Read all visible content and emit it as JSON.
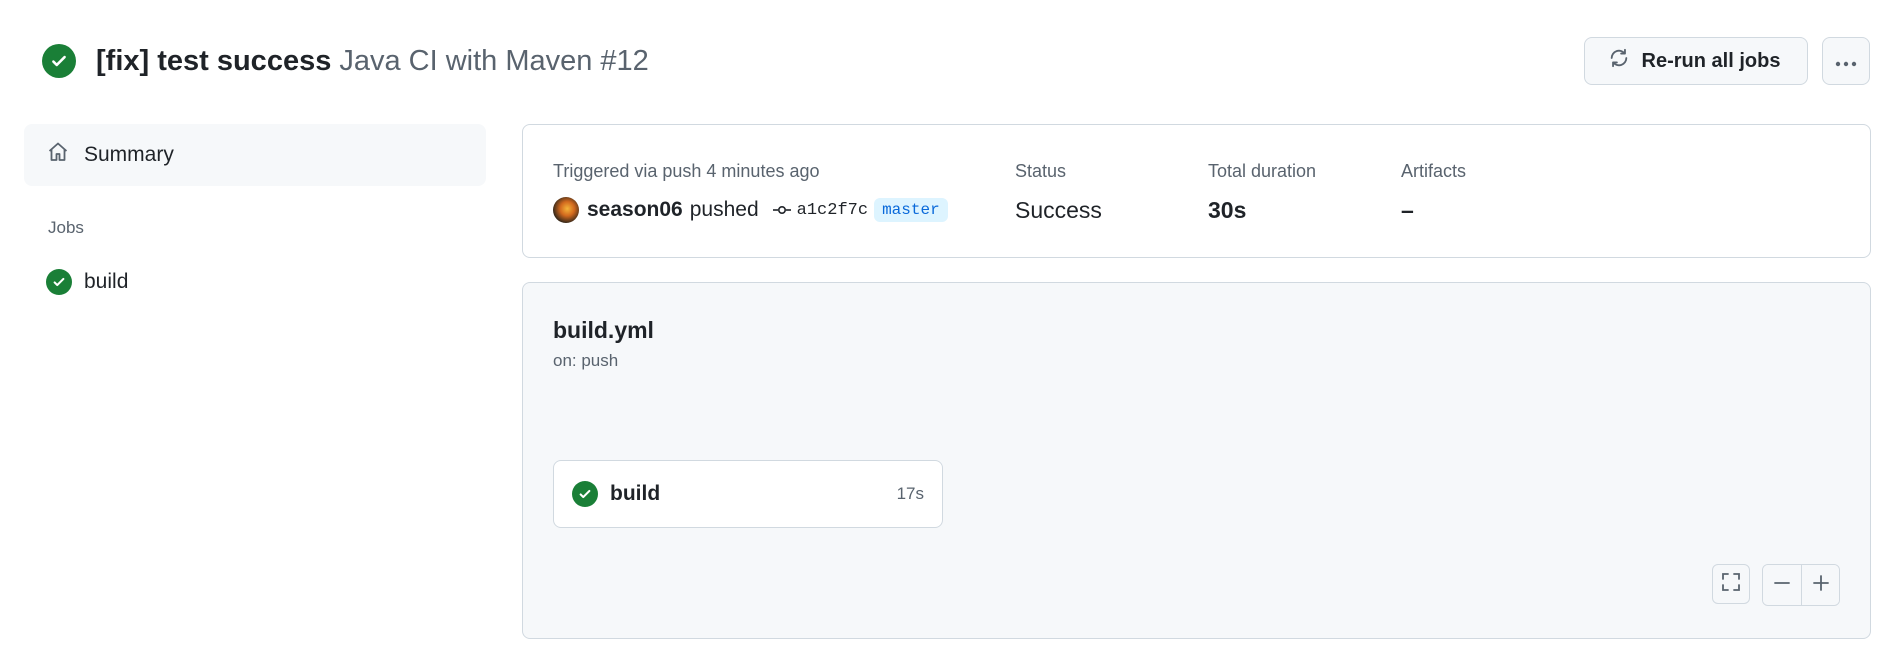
{
  "header": {
    "commit_message": "[fix] test success",
    "workflow_label": "Java CI with Maven #12",
    "rerun_label": "Re-run all jobs",
    "more_icon": "kebab-horizontal-icon",
    "status_icon": "check-circle-fill-icon"
  },
  "sidebar": {
    "summary_label": "Summary",
    "summary_icon": "home-icon",
    "jobs_heading": "Jobs",
    "jobs": [
      {
        "label": "build",
        "status": "success"
      }
    ]
  },
  "summary": {
    "trigger_label": "Triggered via push 4 minutes ago",
    "user": "season06",
    "action": "pushed",
    "commit_sha": "a1c2f7c",
    "branch": "master",
    "status_label": "Status",
    "status_value": "Success",
    "duration_label": "Total duration",
    "duration_value": "30s",
    "artifacts_label": "Artifacts",
    "artifacts_value": "–"
  },
  "graph": {
    "workflow_file": "build.yml",
    "trigger": "on: push",
    "jobs": [
      {
        "name": "build",
        "duration": "17s",
        "status": "success"
      }
    ]
  },
  "colors": {
    "success": "#1a7f37",
    "accent": "#0969da",
    "muted": "#59636e",
    "border": "#d1d9e0",
    "canvas_subtle": "#f6f8fa"
  }
}
